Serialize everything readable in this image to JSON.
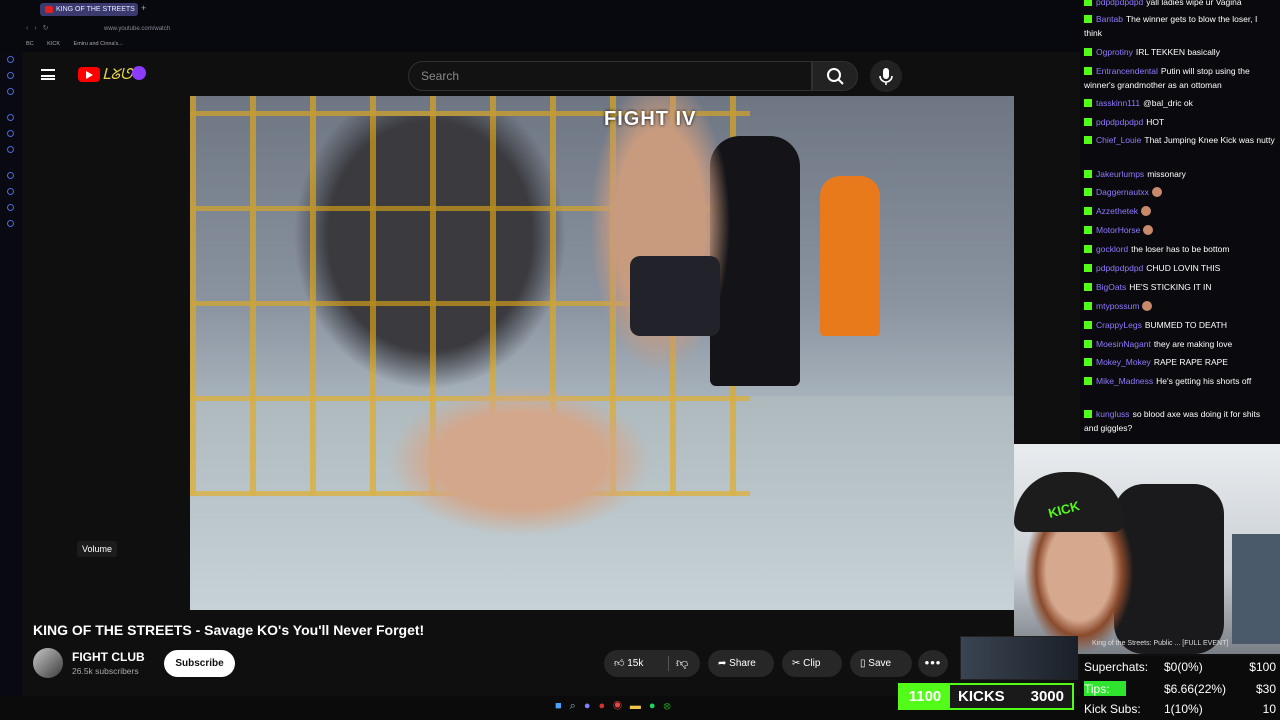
{
  "browser": {
    "tab_title": "KING OF THE STREETS",
    "new_tab": "+",
    "url": "www.youtube.com/watch",
    "bookmarks": [
      "BC",
      "KICK",
      "Emiru and Cinna's..."
    ]
  },
  "youtube": {
    "search_placeholder": "Search",
    "video_overlay_text": "FIGHT IV",
    "volume_tooltip": "Volume",
    "video_title": "KING OF THE STREETS - Savage KO's You'll Never Forget!",
    "channel_name": "FIGHT CLUB",
    "subscribers": "26.5k subscribers",
    "subscribe_label": "Subscribe",
    "like_count": "15k",
    "share_label": "Share",
    "clip_label": "Clip",
    "save_label": "Save",
    "more_label": "•••"
  },
  "chat": {
    "messages": [
      {
        "user": "pdpdpdpdpd",
        "text": "yall ladies wipe ur Vagina"
      },
      {
        "user": "Bantab",
        "text": "The winner gets to blow the loser, I think"
      },
      {
        "user": "Ogprotiny",
        "text": "IRL TEKKEN basically"
      },
      {
        "user": "Entrancendental",
        "text": "Putin will stop using the winner's grandmother as an ottoman"
      },
      {
        "user": "tasskinn111",
        "text": "@bal_dric ok"
      },
      {
        "user": "pdpdpdpdpd",
        "text": "HOT"
      },
      {
        "user": "Chief_Louie",
        "text": "That Jumping Knee Kick was nutty"
      },
      {
        "user": "Jakeurlumps",
        "text": "missonary"
      },
      {
        "user": "Daggernautxx",
        "text": ""
      },
      {
        "user": "Azzethetek",
        "text": ""
      },
      {
        "user": "MotorHorse",
        "text": ""
      },
      {
        "user": "gocklord",
        "text": "the loser has to be bottom"
      },
      {
        "user": "pdpdpdpdpd",
        "text": "CHUD LOVIN THIS"
      },
      {
        "user": "BigOats",
        "text": "HE'S STICKING IT IN"
      },
      {
        "user": "mtypossum",
        "text": ""
      },
      {
        "user": "CrappyLegs",
        "text": "BUMMED TO DEATH"
      },
      {
        "user": "MoesinNagant",
        "text": "they are making love"
      },
      {
        "user": "Mokey_Mokey",
        "text": "RAPE RAPE RAPE"
      },
      {
        "user": "Mike_Madness",
        "text": "He's getting his shorts off"
      },
      {
        "user": "kungluss",
        "text": "so blood axe was doing it for shits and giggles?"
      }
    ]
  },
  "stats": {
    "superchats": {
      "label": "Superchats:",
      "value": "$0(0%)",
      "goal": "$100"
    },
    "tips": {
      "label": "Tips:",
      "value": "$6.66(22%)",
      "goal": "$30",
      "progress_pct": 22
    },
    "kick_subs": {
      "label": "Kick Subs:",
      "value": "1(10%)",
      "goal": "10"
    }
  },
  "kicks": {
    "current": "1100",
    "label": "KICKS",
    "goal": "3000"
  },
  "thumbnail_text": "King of the Streets: Public ... [FULL EVENT]",
  "colors": {
    "kick_green": "#53fc18",
    "yt_red": "#ff0000",
    "chat_user": "#8e7bff"
  }
}
